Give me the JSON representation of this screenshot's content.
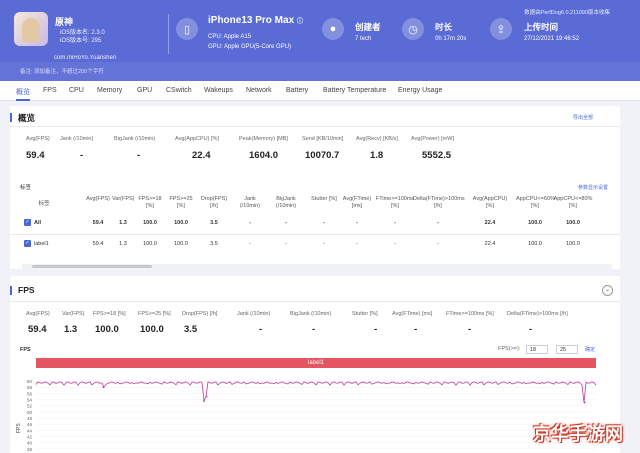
{
  "app": {
    "name": "原神",
    "ios_version": "iOS版本名: 2.3.0",
    "ios_build": "iOS版本号: 295",
    "package": "com.miHoYo.Yuanshen"
  },
  "device": {
    "name": "iPhone13 Pro Max",
    "cpu": "CPU: Apple A15",
    "gpu": "GPU: Apple GPU(5-Core GPU)"
  },
  "stats": [
    {
      "title": "创建者",
      "value": "7 tech",
      "icon": "user-icon"
    },
    {
      "title": "时长",
      "value": "0h 17m 20s",
      "icon": "clock-icon"
    },
    {
      "title": "上传时间",
      "value": "27/12/2021 19:46:52",
      "icon": "upload-icon"
    }
  ],
  "header_note": "备注: 添加备注，不超过200个字符",
  "top_right": "数据由PerfDog6.0.211090版本收集",
  "tabs": [
    "概览",
    "FPS",
    "CPU",
    "Memory",
    "GPU",
    "CSwitch",
    "Wakeups",
    "Network",
    "Battery",
    "Battery Temperature",
    "Energy Usage"
  ],
  "overview": {
    "title": "概览",
    "link": "导出全部",
    "summary": [
      {
        "label": "Avg(FPS)",
        "value": "59.4"
      },
      {
        "label": "Jank (/10min)",
        "value": "-"
      },
      {
        "label": "BigJank (/10min)",
        "value": "-"
      },
      {
        "label": "Avg(AppCPU) [%]",
        "value": "22.4"
      },
      {
        "label": "Peak(Memory) [MB]",
        "value": "1604.0"
      },
      {
        "label": "Send [KB/10min]",
        "value": "10070.7"
      },
      {
        "label": "Avg(Recv) [KB/s]",
        "value": "1.8"
      },
      {
        "label": "Avg(Power) [mW]",
        "value": "5552.5"
      }
    ],
    "tags_label": "标签",
    "tags_link": "参数显示设置",
    "table": {
      "headers": [
        "标签",
        "Avg(FPS)",
        "Var(FPS)",
        "FPS>=18 [%]",
        "FPS>=25 [%]",
        "Drop(FPS) [/h]",
        "Jank (/10min)",
        "BigJank (/10min)",
        "Stutter [%]",
        "Avg(FTime) [ms]",
        "FTime>=100ms [%]",
        "Delta(FTime)>100ms [/h]",
        "Avg(AppCPU) [%]",
        "AppCPU<=60% [%]",
        "AppCPU<=80% [%]"
      ],
      "rows": [
        [
          "All",
          "59.4",
          "1.3",
          "100.0",
          "100.0",
          "3.5",
          "-",
          "-",
          "-",
          "-",
          "-",
          "-",
          "22.4",
          "100.0",
          "100.0"
        ],
        [
          "label1",
          "59.4",
          "1.3",
          "100.0",
          "100.0",
          "3.5",
          "-",
          "-",
          "-",
          "-",
          "-",
          "-",
          "22.4",
          "100.0",
          "100.0"
        ]
      ]
    }
  },
  "fps_section": {
    "title": "FPS",
    "summary": [
      {
        "label": "Avg(FPS)",
        "value": "59.4"
      },
      {
        "label": "Var(FPS)",
        "value": "1.3"
      },
      {
        "label": "FPS>=18 [%]",
        "value": "100.0"
      },
      {
        "label": "FPS>=25 [%]",
        "value": "100.0"
      },
      {
        "label": "Drop(FPS) [/h]",
        "value": "3.5"
      },
      {
        "label": "Jank (/10min)",
        "value": "-"
      },
      {
        "label": "BigJank (/10min)",
        "value": "-"
      },
      {
        "label": "Stutter [%]",
        "value": "-"
      },
      {
        "label": "Avg(FTime) [ms]",
        "value": "-"
      },
      {
        "label": "FTime>=100ms [%]",
        "value": "-"
      },
      {
        "label": "Delta(FTime)>100ms [/h]",
        "value": "-"
      }
    ],
    "chart_title": "FPS",
    "fps_range_label": "FPS(>=):",
    "fps_range_a": "18",
    "fps_range_b": "25",
    "apply_label": "确定",
    "label_bar": "label1"
  },
  "chart_data": {
    "type": "line",
    "title": "FPS",
    "ylabel": "FPS",
    "yticks": [
      60,
      58,
      56,
      54,
      52,
      50,
      48,
      46,
      44,
      42,
      40,
      38,
      36
    ],
    "ylim": [
      35,
      61
    ],
    "series": [
      {
        "name": "label1",
        "color": "#c0399b",
        "baseline": 59.5,
        "dips": [
          {
            "x": 0.3,
            "y": 53.5
          },
          {
            "x": 0.305,
            "y": 55
          },
          {
            "x": 0.12,
            "y": 58
          },
          {
            "x": 0.98,
            "y": 53
          }
        ]
      }
    ]
  },
  "watermark": "京华手游网"
}
